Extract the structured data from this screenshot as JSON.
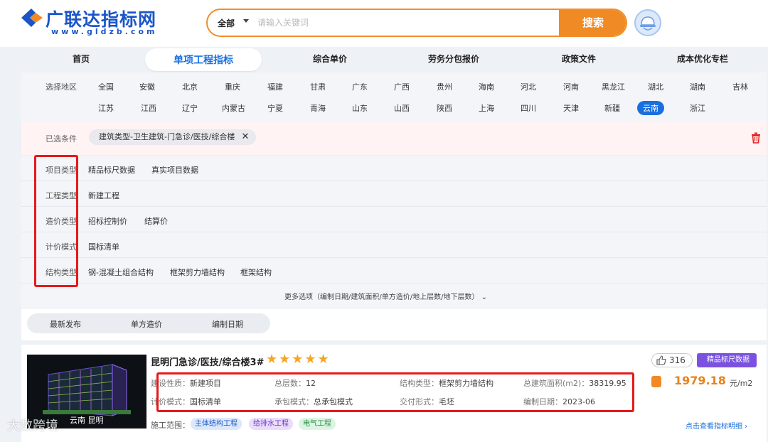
{
  "header": {
    "logo_title": "广联达指标网",
    "logo_sub": "www.gldzb.com",
    "search_scope": "全部",
    "search_placeholder": "请输入关键词",
    "search_button": "搜索"
  },
  "nav": [
    "首页",
    "单项工程指标",
    "综合单价",
    "劳务分包报价",
    "政策文件",
    "成本优化专栏"
  ],
  "region": {
    "label": "选择地区",
    "row1": [
      "全国",
      "安徽",
      "北京",
      "重庆",
      "福建",
      "甘肃",
      "广东",
      "广西",
      "贵州",
      "海南",
      "河北",
      "河南",
      "黑龙江",
      "湖北",
      "湖南",
      "吉林"
    ],
    "row2": [
      "江苏",
      "江西",
      "辽宁",
      "内蒙古",
      "宁夏",
      "青海",
      "山东",
      "山西",
      "陕西",
      "上海",
      "四川",
      "天津",
      "新疆",
      "云南",
      "浙江"
    ],
    "active": "云南"
  },
  "selected": {
    "label": "已选条件",
    "tag": "建筑类型-卫生建筑-门急诊/医技/综合楼",
    "close": "✕"
  },
  "filters": [
    {
      "label": "项目类型",
      "options": [
        "精品标尺数据",
        "真实项目数据"
      ]
    },
    {
      "label": "工程类型",
      "options": [
        "新建工程"
      ]
    },
    {
      "label": "造价类型",
      "options": [
        "招标控制价",
        "结算价"
      ]
    },
    {
      "label": "计价模式",
      "options": [
        "国标清单"
      ]
    },
    {
      "label": "结构类型",
      "options": [
        "钢-混凝土组合结构",
        "框架剪力墙结构",
        "框架结构"
      ]
    }
  ],
  "more_options": "更多选项（编制日期/建筑面积/单方造价/地上层数/地下层数）",
  "sort": [
    "最新发布",
    "单方造价",
    "编制日期"
  ],
  "card": {
    "thumb_caption": "云南 昆明",
    "title": "昆明门急诊/医技/综合楼3#",
    "stars": "★★★★★",
    "likes": "316",
    "badge": "精品标尺数据",
    "info": [
      {
        "k": "建设性质：",
        "v": "新建项目"
      },
      {
        "k": "总层数：",
        "v": "12"
      },
      {
        "k": "结构类型：",
        "v": "框架剪力墙结构"
      },
      {
        "k": "总建筑面积(m2)：",
        "v": "38319.95"
      },
      {
        "k": "计价模式：",
        "v": "国标清单"
      },
      {
        "k": "承包模式：",
        "v": "总承包模式"
      },
      {
        "k": "交付形式：",
        "v": "毛坯"
      },
      {
        "k": "编制日期：",
        "v": "2023-06"
      }
    ],
    "price": "1979.18",
    "price_unit": "元/m2",
    "scope_label": "施工范围：",
    "scope_tags": [
      "主体结构工程",
      "给排水工程",
      "电气工程"
    ],
    "detail_link": "点击查看指标明细 ›"
  },
  "watermark": "大数跨境"
}
